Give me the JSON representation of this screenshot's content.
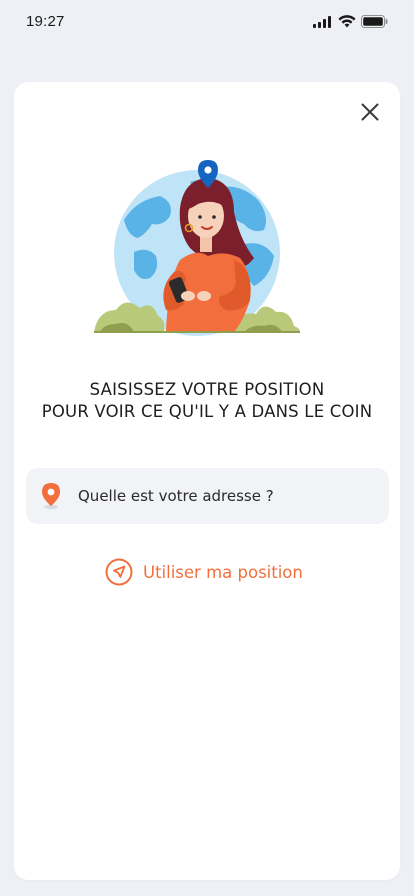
{
  "status_bar": {
    "time": "19:27"
  },
  "sheet": {
    "close_icon": "close-icon",
    "headline_line1": "SAISISSEZ VOTRE POSITION",
    "headline_line2": "POUR VOIR CE QU'IL Y A DANS LE COIN",
    "address_placeholder": "Quelle est votre adresse ?",
    "use_position_label": "Utiliser ma position"
  },
  "colors": {
    "accent": "#f26f3d",
    "field_bg": "#f1f3f7",
    "page_bg": "#eef0f5",
    "pin_blue": "#1565c0"
  }
}
